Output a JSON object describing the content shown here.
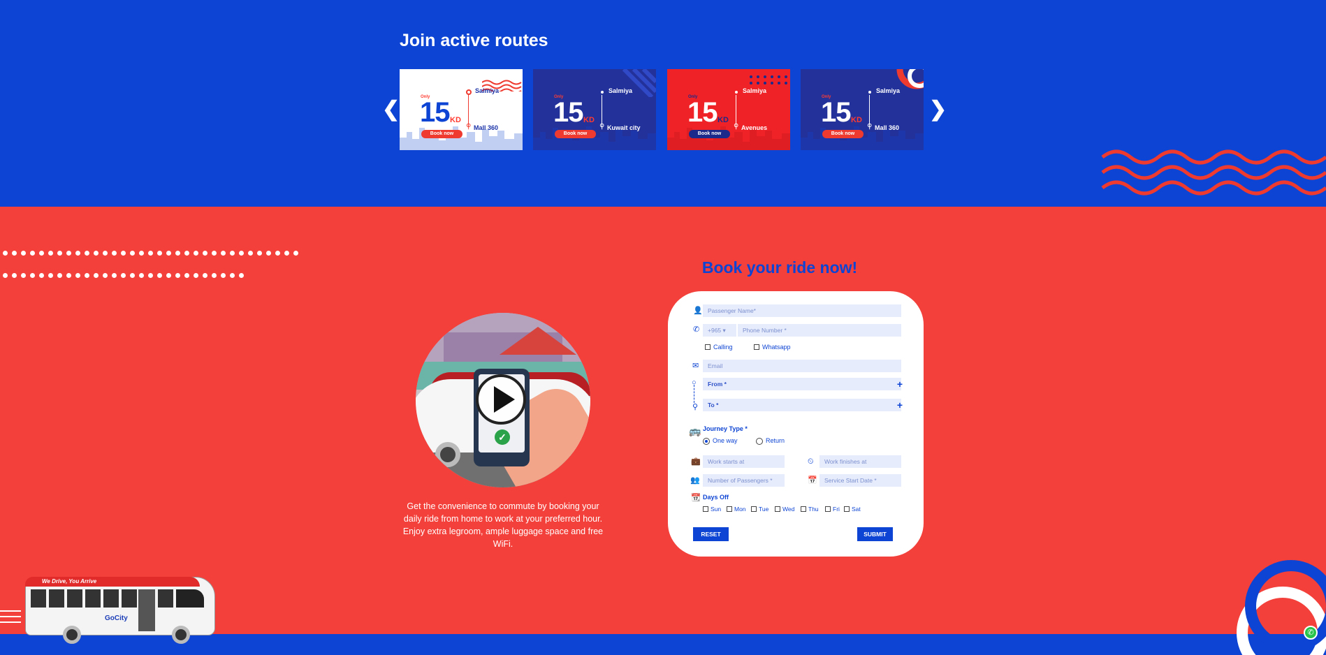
{
  "routes_section": {
    "title": "Join active routes",
    "prev_arrow": "❮",
    "next_arrow": "❯",
    "cards": [
      {
        "only": "Only",
        "price": "15",
        "currency": "KD",
        "from": "Salmiya",
        "to": "Mall 360",
        "book": "Book now"
      },
      {
        "only": "Only",
        "price": "15",
        "currency": "KD",
        "from": "Salmiya",
        "to": "Kuwait city",
        "book": "Book now"
      },
      {
        "only": "Only",
        "price": "15",
        "currency": "KD",
        "from": "Salmiya",
        "to": "Avenues",
        "book": "Book now"
      },
      {
        "only": "Only",
        "price": "15",
        "currency": "KD",
        "from": "Salmiya",
        "to": "Mall 360",
        "book": "Book now"
      }
    ]
  },
  "promo": {
    "description": "Get the convenience to commute by booking your daily ride from home to work at your preferred hour. Enjoy extra legroom, ample luggage space and free WiFi."
  },
  "booking_form": {
    "title": "Book your ride now!",
    "passenger_name": "Passenger Name*",
    "country_code": "+965",
    "phone": "Phone Number *",
    "calling": "Calling",
    "whatsapp": "Whatsapp",
    "email": "Email",
    "from": "From *",
    "to": "To *",
    "journey_type_label": "Journey Type *",
    "one_way": "One way",
    "return": "Return",
    "work_starts": "Work starts at",
    "work_finishes": "Work finishes at",
    "num_passengers": "Number of Passengers *",
    "service_start": "Service Start Date *",
    "days_off_label": "Days Off",
    "days": [
      "Sun",
      "Mon",
      "Tue",
      "Wed",
      "Thu",
      "Fri",
      "Sat"
    ],
    "reset": "RESET",
    "submit": "SUBMIT"
  },
  "bus": {
    "slogan": "We Drive, You Arrive",
    "brand": "GoCity"
  },
  "colors": {
    "blue": "#0d44d3",
    "red": "#f3403a",
    "navy": "#23329b"
  }
}
